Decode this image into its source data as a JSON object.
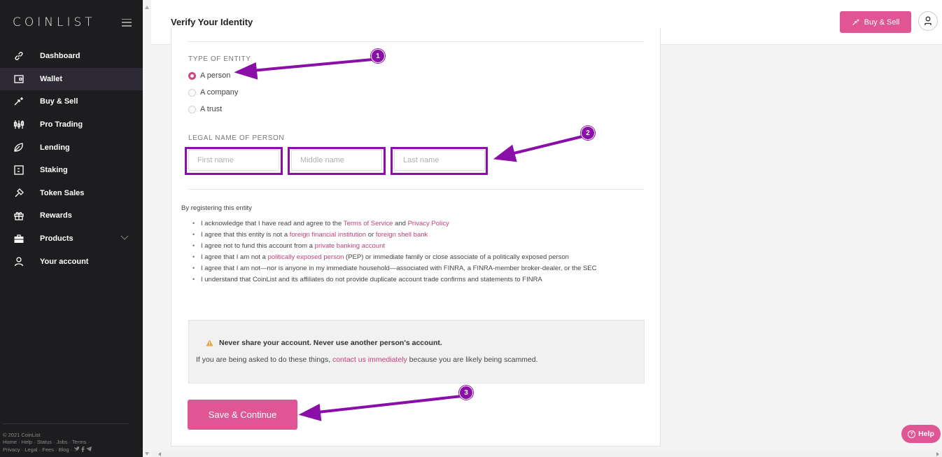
{
  "brand": {
    "logo": "COINLIST",
    "accent": "#e05593",
    "annotation_color": "#8a0fa8"
  },
  "sidebar": {
    "items": [
      {
        "label": "Dashboard",
        "icon": "link-icon"
      },
      {
        "label": "Wallet",
        "icon": "wallet-icon",
        "active": true
      },
      {
        "label": "Buy & Sell",
        "icon": "sparkle-arrow-icon"
      },
      {
        "label": "Pro Trading",
        "icon": "candlestick-icon"
      },
      {
        "label": "Lending",
        "icon": "lending-icon"
      },
      {
        "label": "Staking",
        "icon": "staking-icon"
      },
      {
        "label": "Token Sales",
        "icon": "token-sales-icon"
      },
      {
        "label": "Rewards",
        "icon": "gift-icon"
      },
      {
        "label": "Products",
        "icon": "briefcase-icon"
      },
      {
        "label": "Your account",
        "icon": "user-icon"
      }
    ],
    "footer": {
      "copyright": "© 2021 CoinList",
      "line1": "Home · Help · Status · Jobs · Terms ·",
      "line2": "Privacy · Legal · Fees · Blog ·"
    }
  },
  "header": {
    "title": "Verify Your Identity",
    "buy_sell_label": "Buy & Sell"
  },
  "form": {
    "entity_type_label": "TYPE OF ENTITY",
    "entity_options": [
      "A person",
      "A company",
      "A trust"
    ],
    "selected_entity": "A person",
    "legal_name_label": "LEGAL NAME OF PERSON",
    "placeholders": {
      "first": "First name",
      "middle": "Middle name",
      "last": "Last name"
    }
  },
  "terms": {
    "intro": "By registering this entity",
    "t1a": "I acknowledge that I have read and agree to the ",
    "t1_link1": "Terms of Service",
    "t1_and": " and ",
    "t1_link2": "Privacy Policy",
    "t2a": "I agree that this entity is not a ",
    "t2_link1": "foreign financial institution",
    "t2_or": " or ",
    "t2_link2": "foreign shell bank",
    "t3a": "I agree not to fund this account from a ",
    "t3_link": "private banking account",
    "t4a": "I agree that I am not a ",
    "t4_link": "politically exposed person",
    "t4b": " (PEP) or immediate family or close associate of a politically exposed person",
    "t5": "I agree that I am not—nor is anyone in my immediate household—associated with FINRA, a FINRA-member broker-dealer, or the SEC",
    "t6": "I understand that CoinList and its affiliates do not provide duplicate account trade confirms and statements to FINRA"
  },
  "warning": {
    "title": "Never share your account. Never use another person's account.",
    "body_a": "If you are being asked to do these things, ",
    "body_link": "contact us immediately",
    "body_b": " because you are likely being scammed."
  },
  "actions": {
    "save_label": "Save & Continue",
    "help_label": "Help"
  },
  "annotations": {
    "b1": "1",
    "b2": "2",
    "b3": "3"
  }
}
